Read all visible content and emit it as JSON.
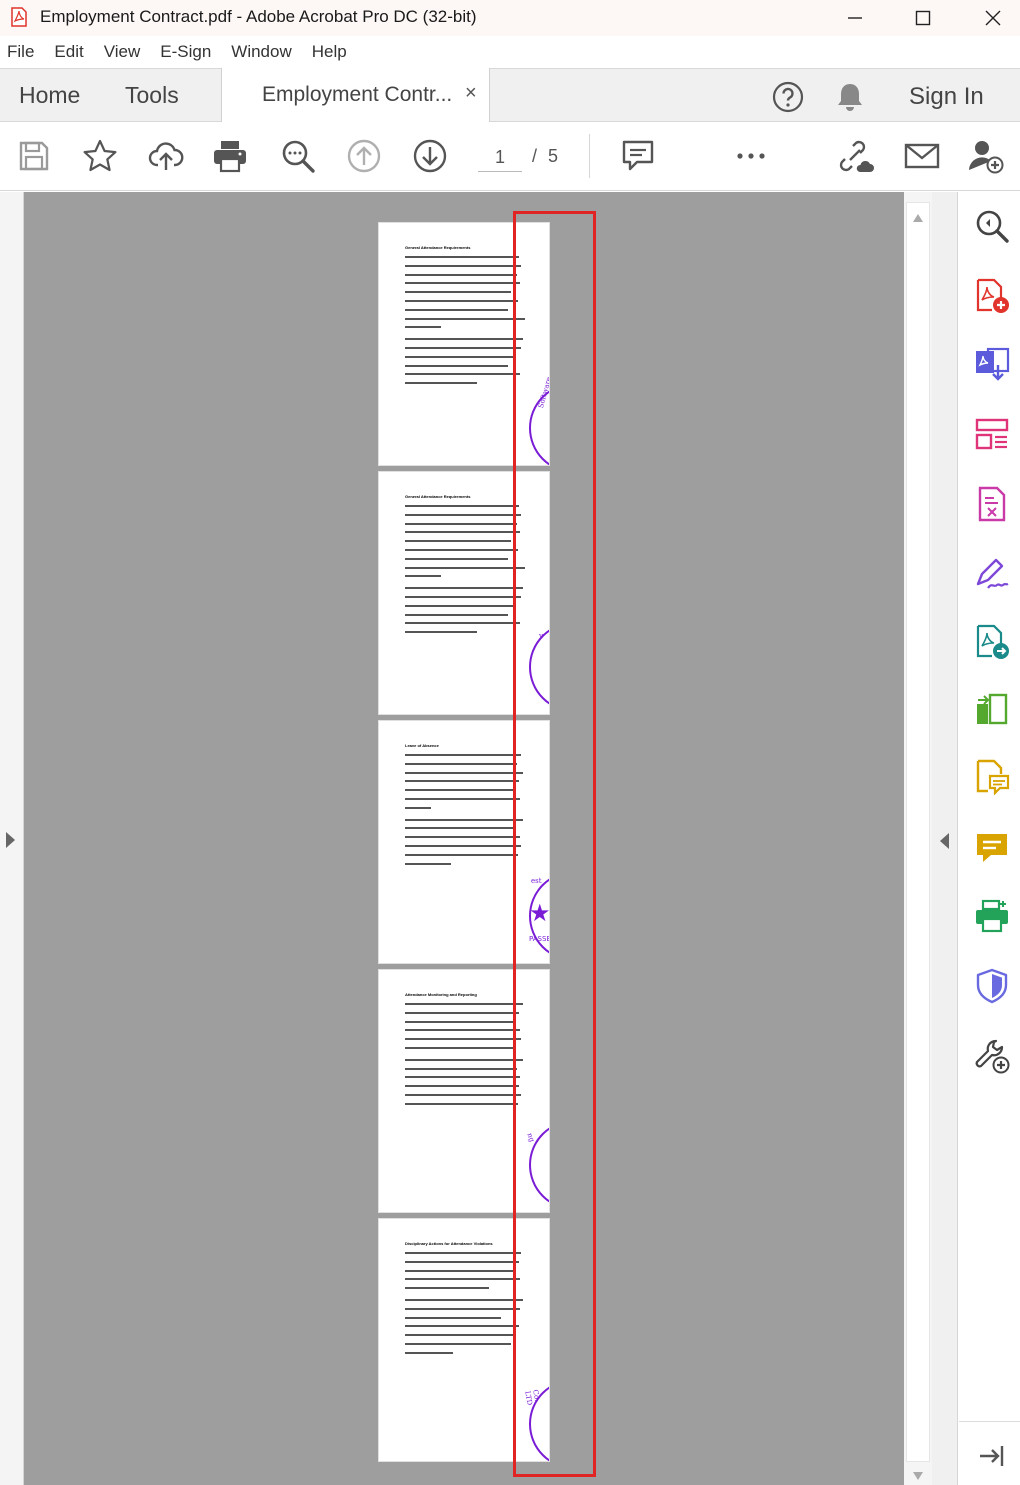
{
  "window": {
    "title": "Employment Contract.pdf - Adobe Acrobat Pro DC (32-bit)"
  },
  "menu": [
    "File",
    "Edit",
    "View",
    "E-Sign",
    "Window",
    "Help"
  ],
  "tabs": {
    "home": "Home",
    "tools": "Tools",
    "document": "Employment Contr...",
    "close": "×"
  },
  "header": {
    "sign_in": "Sign In"
  },
  "toolbar": {
    "current_page": "1",
    "separator": "/",
    "total_pages": "5"
  },
  "pages": [
    {
      "heading": "General Attendance Requirements",
      "stamp_text": "Software"
    },
    {
      "heading": "General Attendance Requirements",
      "stamp_text": "y"
    },
    {
      "heading": "Leave of Absence",
      "stamp_text": "est",
      "stamp_label": "PASSE"
    },
    {
      "heading": "Attendance Monitoring and Reporting",
      "stamp_text": "ng"
    },
    {
      "heading": "Disciplinary Actions for Attendance Violations",
      "stamp_text": "Co. LTD"
    }
  ],
  "colors": {
    "stamp": "#7a1cd6",
    "highlight_box": "#e02424",
    "acrobat_red": "#e0342c"
  }
}
